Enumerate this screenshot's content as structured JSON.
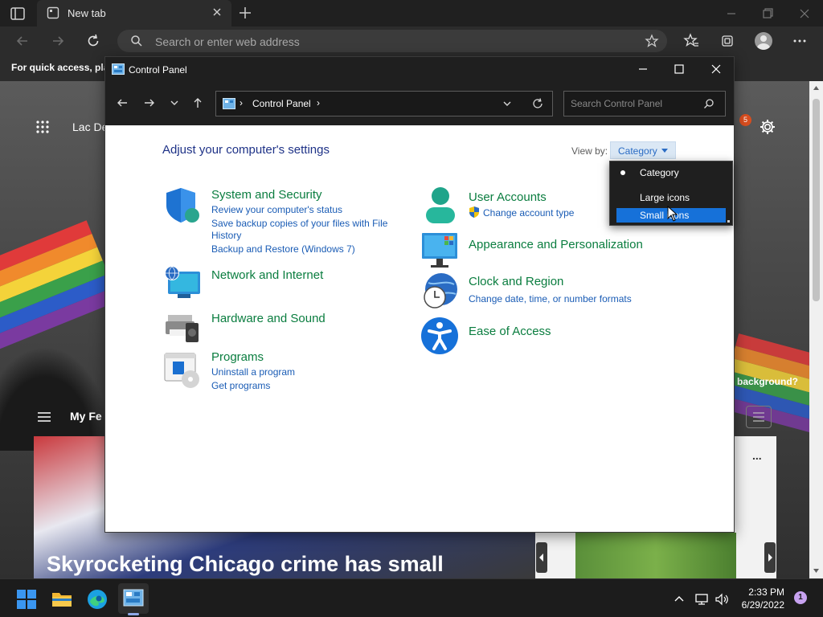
{
  "browser": {
    "tab_title": "New tab",
    "address_placeholder": "Search or enter web address",
    "favorites_bar_text": "For quick access, plac"
  },
  "newtab": {
    "location_text": "Lac De",
    "notification_count": "5",
    "background_prompt": "background?",
    "feed_label": "My Fe",
    "headline": "Skyrocketing Chicago crime has small",
    "more_label": "..."
  },
  "control_panel": {
    "window_title": "Control Panel",
    "breadcrumb": "Control Panel",
    "search_placeholder": "Search Control Panel",
    "heading": "Adjust your computer's settings",
    "view_by_label": "View by:",
    "view_by_value": "Category",
    "view_options": [
      "Category",
      "Large icons",
      "Small icons"
    ],
    "categories": [
      {
        "title": "System and Security",
        "links": [
          "Review your computer's status",
          "Save backup copies of your files with File",
          "History",
          "Backup and Restore (Windows 7)"
        ]
      },
      {
        "title": "Network and Internet",
        "links": []
      },
      {
        "title": "Hardware and Sound",
        "links": []
      },
      {
        "title": "Programs",
        "links": [
          "Uninstall a program",
          "Get programs"
        ]
      },
      {
        "title": "User Accounts",
        "links": [
          "Change account type"
        ]
      },
      {
        "title": "Appearance and Personalization",
        "links": []
      },
      {
        "title": "Clock and Region",
        "links": [
          "Change date, time, or number formats"
        ]
      },
      {
        "title": "Ease of Access",
        "links": []
      }
    ]
  },
  "taskbar": {
    "time": "2:33 PM",
    "date": "6/29/2022",
    "notification_count": "1"
  },
  "colors": {
    "accent": "#1671d9",
    "category_title": "#0a7d3f",
    "link": "#1a5cb5",
    "heading": "#1e3287"
  }
}
